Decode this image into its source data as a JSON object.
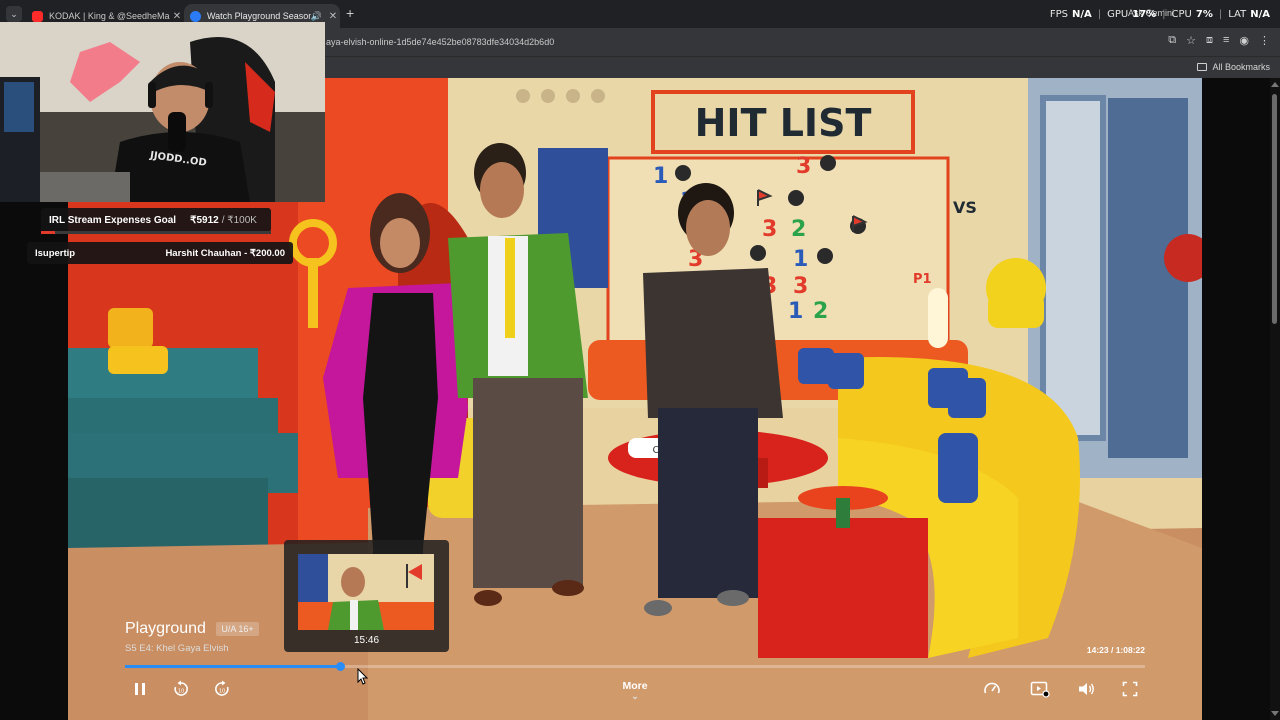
{
  "browser": {
    "tabs": [
      {
        "title": "KODAK | King & @SeedheMaut",
        "fav_color": "#ff2a2a",
        "active": false
      },
      {
        "title": "Watch Playground Season",
        "fav_color": "#2a7bf5",
        "active": true
      }
    ],
    "new_tab": "+",
    "url": "aya-elvish-online-1d5de74e452be08783dfe34034d2b6d0",
    "bookmarks_label": "All Bookmarks",
    "gemini_label": "Ask Gemini"
  },
  "stats": {
    "fps_label": "FPS",
    "fps_value": "N/A",
    "gpu_label": "GPU",
    "gpu_value": "17%",
    "cpu_label": "CPU",
    "cpu_value": "7%",
    "lat_label": "LAT",
    "lat_value": "N/A"
  },
  "stream": {
    "goal_label": "IRL Stream Expenses Goal",
    "goal_amount": "₹5912",
    "goal_target": "/ ₹100K",
    "goal_progress": 0.059,
    "tip_label": "Isupertip",
    "tip_value": "Harshit Chauhan - ₹200.00",
    "shirt_text": "JJODD..OD"
  },
  "scene": {
    "sign": "HIT LIST",
    "vs": "VS",
    "p1": "P1",
    "board_numbers": [
      "1",
      "3",
      "1",
      "3",
      "2",
      "1",
      "3",
      "3",
      "1",
      "2",
      "3"
    ],
    "table_text": "ONL"
  },
  "player": {
    "title": "Playground",
    "rating": "U/A 16+",
    "episode": "S5 E4: Khel Gaya Elvish",
    "time": "14:23 / 1:08:22",
    "progress": 0.211,
    "preview_time": "15:46",
    "more_label": "More",
    "more_chevron": "⌄"
  }
}
